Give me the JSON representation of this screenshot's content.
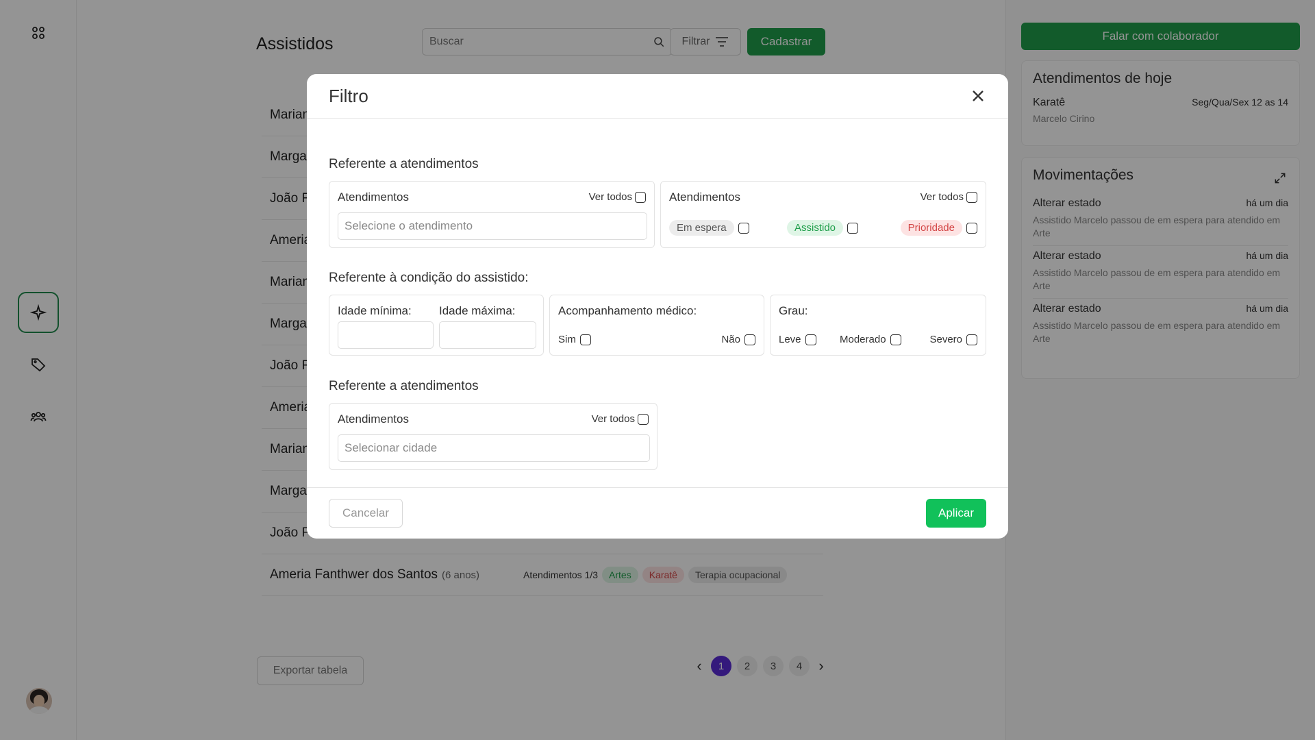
{
  "main": {
    "title": "Assistidos",
    "search_placeholder": "Buscar",
    "filter_label": "Filtrar",
    "register_label": "Cadastrar",
    "rows": [
      {
        "name": "Mariana"
      },
      {
        "name": "Margar"
      },
      {
        "name": "João Fe"
      },
      {
        "name": "Ameria"
      },
      {
        "name": "Mariana"
      },
      {
        "name": "Margar"
      },
      {
        "name": "João Fe"
      },
      {
        "name": "Ameria"
      },
      {
        "name": "Mariana"
      },
      {
        "name": "Margar"
      },
      {
        "name": "João Fe"
      },
      {
        "name": "Ameria Fanthwer dos Santos",
        "age": "(6 anos)",
        "attendance": "Atendimentos 1/3",
        "tags": [
          "Artes",
          "Karatê",
          "Terapia ocupacional"
        ]
      }
    ],
    "export_label": "Exportar tabela",
    "pagination": {
      "pages": [
        "1",
        "2",
        "3",
        "4"
      ],
      "current": "1",
      "prev": "‹",
      "next": "›"
    }
  },
  "right": {
    "talk_label": "Falar com colaborador",
    "today": {
      "title": "Atendimentos de hoje",
      "activity": "Karatê",
      "schedule": "Seg/Qua/Sex 12 as 14",
      "teacher": "Marcelo Cirino"
    },
    "movements": {
      "title": "Movimentações",
      "items": [
        {
          "action": "Alterar estado",
          "when": "há um dia",
          "desc": "Assistido Marcelo passou de em espera para atendido em Arte"
        },
        {
          "action": "Alterar estado",
          "when": "há um dia",
          "desc": "Assistido Marcelo passou de em espera para atendido em Arte"
        },
        {
          "action": "Alterar estado",
          "when": "há um dia",
          "desc": "Assistido Marcelo passou de em espera para atendido em Arte"
        }
      ]
    }
  },
  "modal": {
    "title": "Filtro",
    "section1": "Referente a atendimentos",
    "box1": {
      "label": "Atendimentos",
      "see_all": "Ver todos",
      "placeholder": "Selecione o atendimento"
    },
    "box2": {
      "label": "Atendimentos",
      "see_all": "Ver todos",
      "statuses": [
        "Em espera",
        "Assistido",
        "Prioridade"
      ]
    },
    "section2": "Referente à condição do assistido:",
    "age": {
      "min_label": "Idade mínima:",
      "max_label": "Idade máxima:"
    },
    "medical": {
      "label": "Acompanhamento médico:",
      "yes": "Sim",
      "no": "Não"
    },
    "grade": {
      "label": "Grau:",
      "options": [
        "Leve",
        "Moderado",
        "Severo"
      ]
    },
    "section3": "Referente a atendimentos",
    "box3": {
      "label": "Atendimentos",
      "see_all": "Ver todos",
      "placeholder": "Selecionar cidade"
    },
    "cancel": "Cancelar",
    "apply": "Aplicar"
  }
}
